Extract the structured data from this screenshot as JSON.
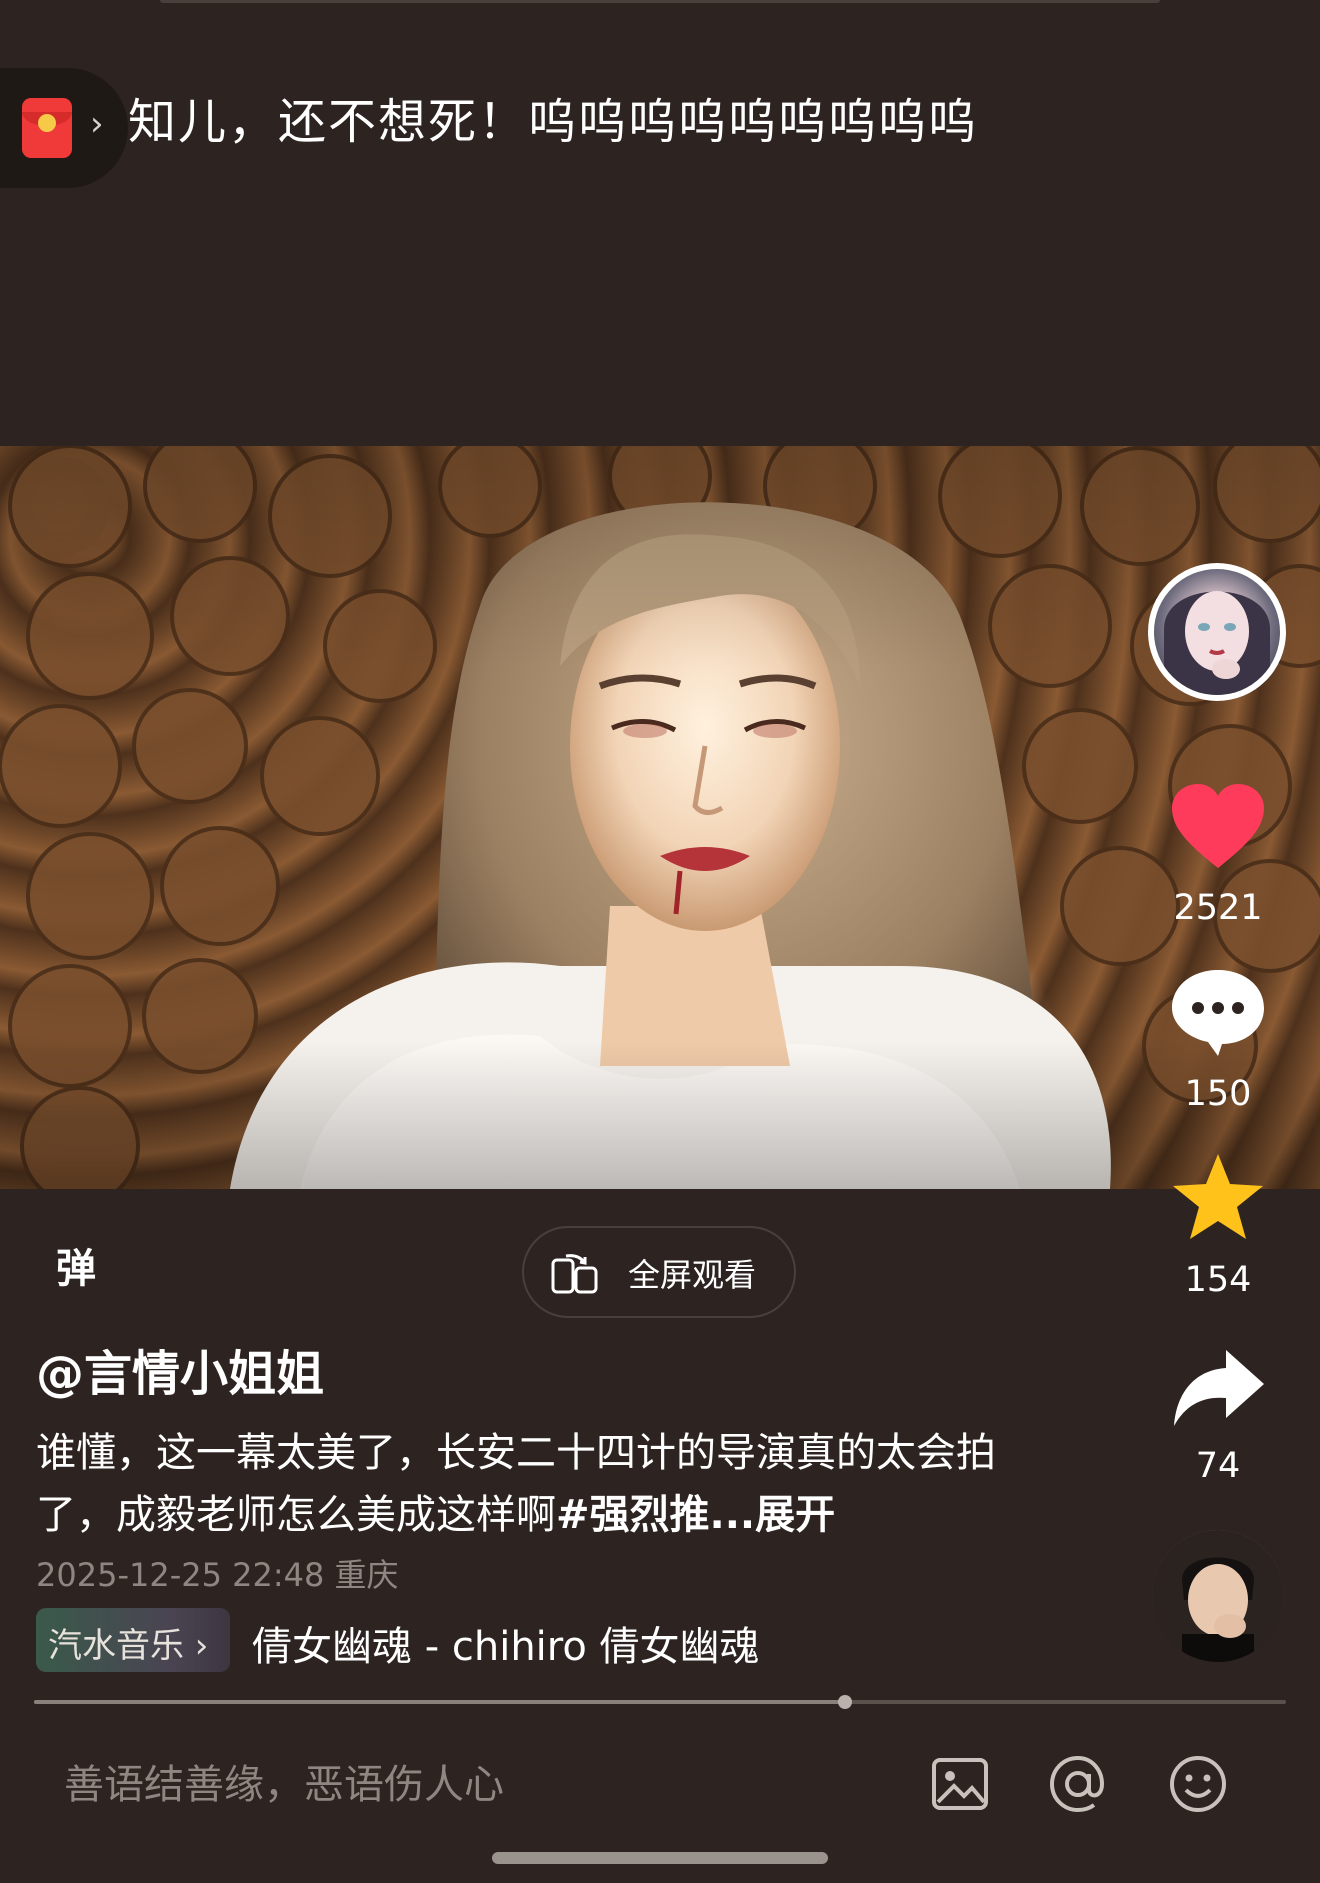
{
  "top": {
    "danmaku_text": "知儿，还不想死！呜呜呜呜呜呜呜呜呜",
    "red_packet_icon": "red-packet-icon",
    "chevron_icon": "chevron-right-icon"
  },
  "actions": {
    "like_count": "2521",
    "comment_count": "150",
    "favorite_count": "154",
    "share_count": "74",
    "colors": {
      "like": "#ff3b5c",
      "favorite": "#ffc21a",
      "icon": "#ffffff"
    }
  },
  "controls": {
    "danmaku_toggle": "弹",
    "fullscreen_label": "全屏观看"
  },
  "post": {
    "author": "@言情小姐姐",
    "description": "谁懂，这一幕太美了，长安二十四计的导演真的太会拍了，成毅老师怎么美成这样啊",
    "hashtag": "#强烈推",
    "expand": "...展开",
    "datetime": "2025-12-25 22:48",
    "location": "重庆"
  },
  "music": {
    "badge": "汽水音乐",
    "text": "倩女幽魂 - chihiro  倩女幽魂"
  },
  "progress": {
    "fraction": 0.648
  },
  "comment_bar": {
    "placeholder": "善语结善缘，恶语伤人心",
    "icons": [
      "image-icon",
      "at-icon",
      "emoji-icon"
    ]
  }
}
